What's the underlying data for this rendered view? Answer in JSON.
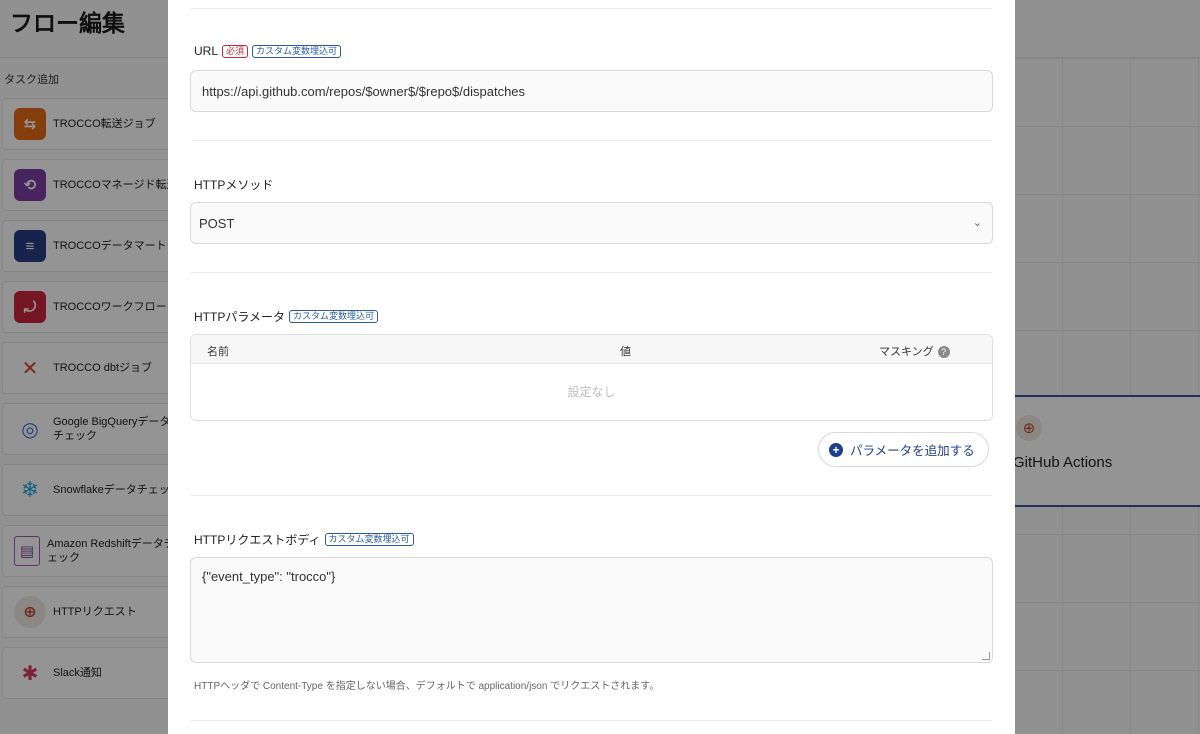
{
  "background": {
    "page_title": "フロー編集",
    "section_label": "タスク追加",
    "tasks": [
      {
        "label": "TROCCO転送ジョブ",
        "icon": "transfer-arrows-icon"
      },
      {
        "label": "TROCCOマネージド転送",
        "icon": "managed-transfer-icon"
      },
      {
        "label": "TROCCOデータマートジ",
        "icon": "database-icon"
      },
      {
        "label": "TROCCOワークフロー",
        "icon": "workflow-icon"
      },
      {
        "label": "TROCCO dbtジョブ",
        "icon": "dbt-icon"
      },
      {
        "label": "Google BigQueryデータチェック",
        "icon": "bigquery-icon"
      },
      {
        "label": "Snowflakeデータチェック",
        "icon": "snowflake-icon"
      },
      {
        "label": "Amazon Redshiftデータチェック",
        "icon": "redshift-icon"
      },
      {
        "label": "HTTPリクエスト",
        "icon": "globe-icon"
      },
      {
        "label": "Slack通知",
        "icon": "slack-icon"
      }
    ],
    "node_label": "GitHub Actions"
  },
  "modal": {
    "url": {
      "label": "URL",
      "required_badge": "必須",
      "custom_badge": "カスタム変数埋込可",
      "value": "https://api.github.com/repos/$owner$/$repo$/dispatches"
    },
    "method": {
      "label": "HTTPメソッド",
      "value": "POST"
    },
    "params": {
      "label": "HTTPパラメータ",
      "custom_badge": "カスタム変数埋込可",
      "columns": [
        "名前",
        "値",
        "マスキング"
      ],
      "empty_text": "設定なし",
      "add_button": "パラメータを追加する"
    },
    "body": {
      "label": "HTTPリクエストボディ",
      "custom_badge": "カスタム変数埋込可",
      "value": "{\"event_type\": \"trocco\"}",
      "hint": "HTTPヘッダで Content-Type を指定しない場合、デフォルトで application/json でリクエストされます。"
    }
  }
}
